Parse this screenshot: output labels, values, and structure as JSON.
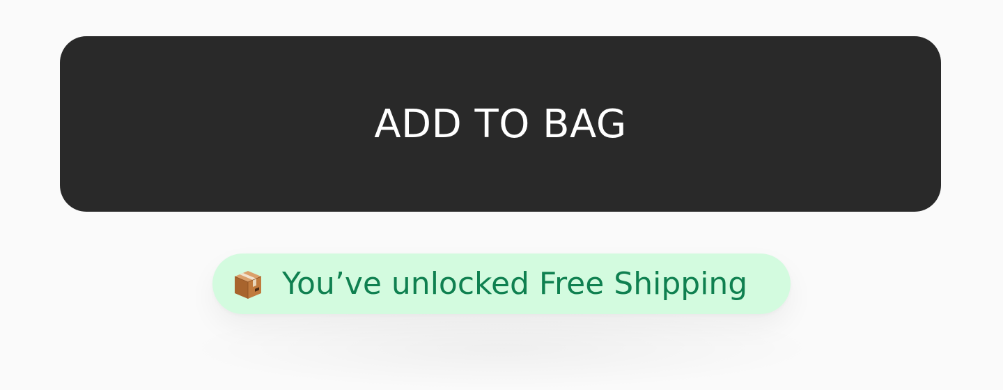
{
  "cart": {
    "add_button_label": "ADD TO BAG"
  },
  "shipping_notice": {
    "icon": "package-icon",
    "text": "You’ve unlocked Free Shipping"
  },
  "colors": {
    "page_background": "#fafafa",
    "button_background": "#292929",
    "button_text": "#ffffff",
    "notice_background": "#d3fbdf",
    "notice_text": "#0f8050"
  }
}
